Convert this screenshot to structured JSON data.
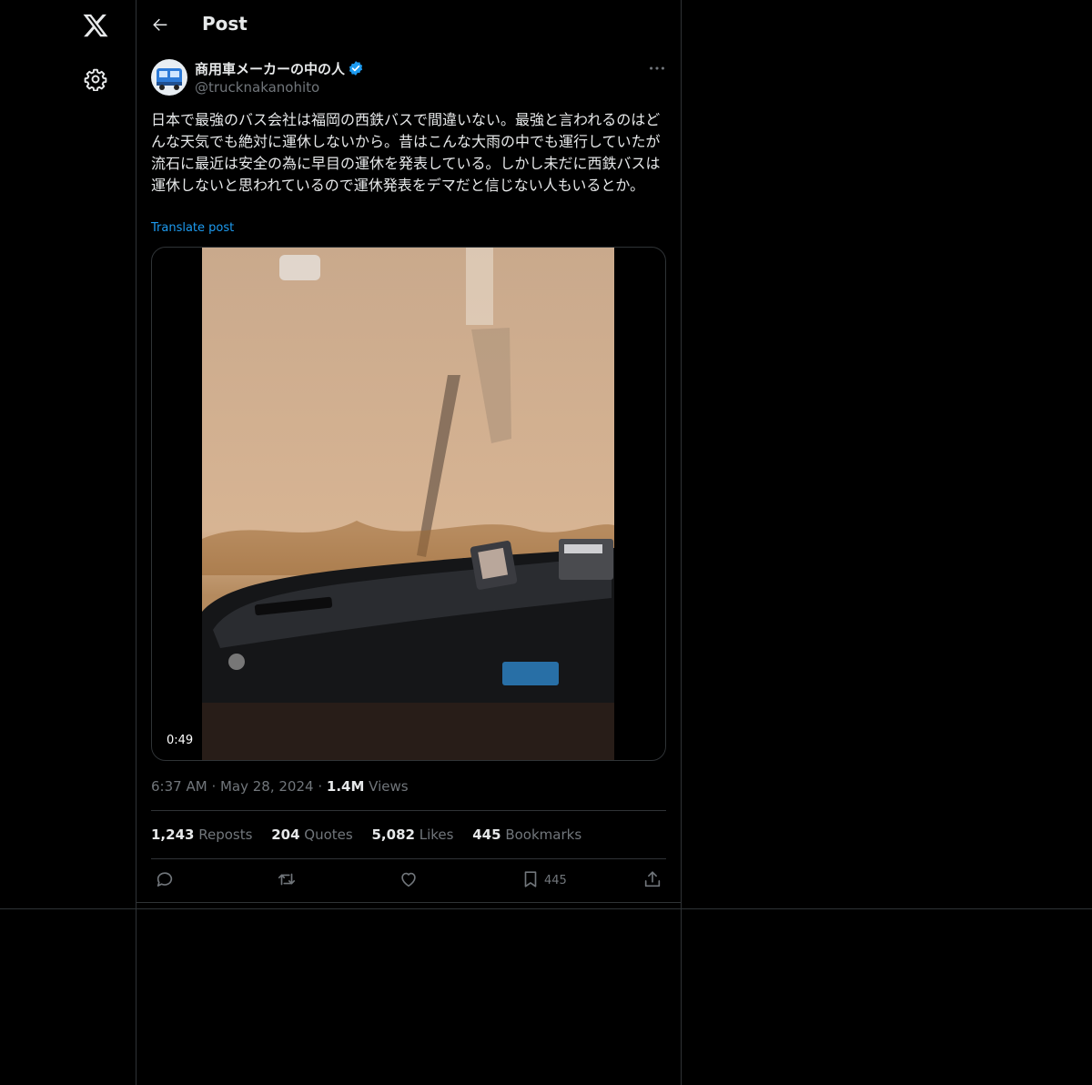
{
  "header": {
    "title": "Post"
  },
  "post": {
    "author_name": "商用車メーカーの中の人",
    "author_handle": "@trucknakanohito",
    "text": "日本で最強のバス会社は福岡の西鉄バスで間違いない。最強と言われるのはどんな天気でも絶対に運休しないから。昔はこんな大雨の中でも運行していたが流石に最近は安全の為に早目の運休を発表している。しかし未だに西鉄バスは運休しないと思われているので運休発表をデマだと信じない人もいるとか。",
    "translate_label": "Translate post",
    "video_duration": "0:49",
    "time": "6:37 AM",
    "date": "May 28, 2024",
    "views_count": "1.4M",
    "views_label": "Views"
  },
  "stats": [
    {
      "count": "1,243",
      "label": "Reposts"
    },
    {
      "count": "204",
      "label": "Quotes"
    },
    {
      "count": "5,082",
      "label": "Likes"
    },
    {
      "count": "445",
      "label": "Bookmarks"
    }
  ],
  "actions": {
    "bookmark_count": "445"
  },
  "icons": {
    "nav": [
      "x-logo-icon",
      "settings-gear-icon"
    ],
    "header": [
      "back-arrow-icon"
    ],
    "post": [
      "verified-badge-icon",
      "more-icon"
    ],
    "actions": [
      "reply-icon",
      "repost-icon",
      "like-icon",
      "bookmark-icon",
      "share-icon"
    ]
  },
  "colors": {
    "background": "#000000",
    "text": "#e7e9ea",
    "muted": "#71767b",
    "accent": "#1d9bf0",
    "border": "#2f3336"
  }
}
